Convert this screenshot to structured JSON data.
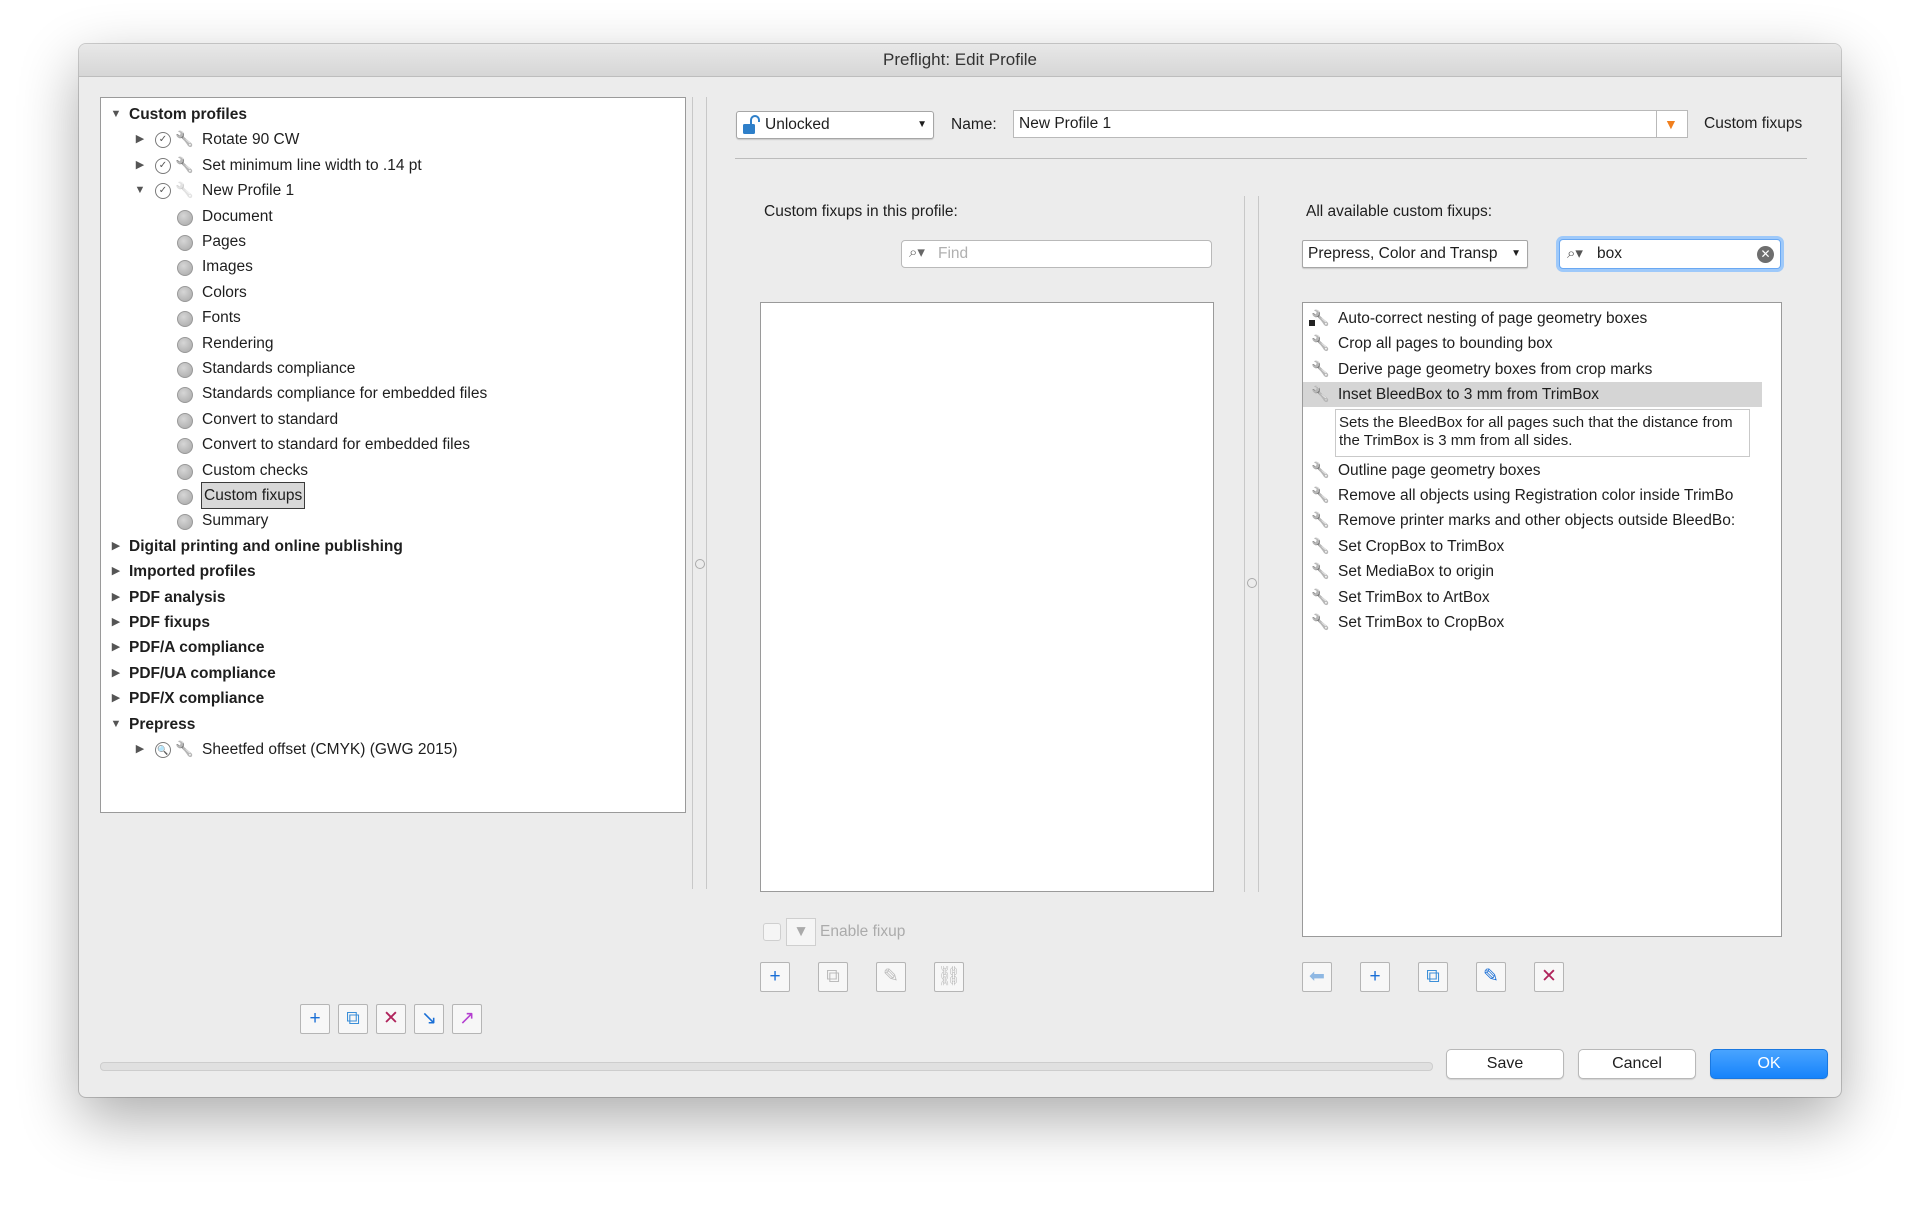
{
  "window": {
    "title": "Preflight: Edit Profile"
  },
  "tree": [
    {
      "label": "Custom profiles",
      "level": 0,
      "bold": true,
      "expanded": true
    },
    {
      "label": "Rotate 90 CW",
      "level": 1,
      "expanded": false,
      "icons": [
        "check-circle-icon",
        "wrench-icon"
      ]
    },
    {
      "label": "Set minimum line width to .14 pt",
      "level": 1,
      "expanded": false,
      "icons": [
        "check-circle-icon",
        "wrench-icon"
      ]
    },
    {
      "label": "New Profile 1",
      "level": 1,
      "expanded": true,
      "icons": [
        "check-circle-icon",
        "wrench-icon"
      ]
    },
    {
      "label": "Document",
      "level": 2,
      "dot": true
    },
    {
      "label": "Pages",
      "level": 2,
      "dot": true
    },
    {
      "label": "Images",
      "level": 2,
      "dot": true
    },
    {
      "label": "Colors",
      "level": 2,
      "dot": true
    },
    {
      "label": "Fonts",
      "level": 2,
      "dot": true
    },
    {
      "label": "Rendering",
      "level": 2,
      "dot": true
    },
    {
      "label": "Standards compliance",
      "level": 2,
      "dot": true
    },
    {
      "label": "Standards compliance for embedded files",
      "level": 2,
      "dot": true
    },
    {
      "label": "Convert to standard",
      "level": 2,
      "dot": true
    },
    {
      "label": "Convert to standard for embedded files",
      "level": 2,
      "dot": true
    },
    {
      "label": "Custom checks",
      "level": 2,
      "dot": true
    },
    {
      "label": "Custom fixups",
      "level": 2,
      "dot": true,
      "selected": true
    },
    {
      "label": "Summary",
      "level": 2,
      "dot": true
    },
    {
      "label": "Digital printing and online publishing",
      "level": 0,
      "bold": true,
      "expanded": false
    },
    {
      "label": "Imported profiles",
      "level": 0,
      "bold": true,
      "expanded": false
    },
    {
      "label": "PDF analysis",
      "level": 0,
      "bold": true,
      "expanded": false
    },
    {
      "label": "PDF fixups",
      "level": 0,
      "bold": true,
      "expanded": false
    },
    {
      "label": "PDF/A compliance",
      "level": 0,
      "bold": true,
      "expanded": false
    },
    {
      "label": "PDF/UA compliance",
      "level": 0,
      "bold": true,
      "expanded": false
    },
    {
      "label": "PDF/X compliance",
      "level": 0,
      "bold": true,
      "expanded": false
    },
    {
      "label": "Prepress",
      "level": 0,
      "bold": true,
      "expanded": true
    },
    {
      "label": "Sheetfed offset (CMYK) (GWG 2015)",
      "level": 1,
      "expanded": false,
      "icons": [
        "lock-magnifier-icon",
        "wrench-icon"
      ]
    }
  ],
  "left_toolbar": [
    {
      "name": "add-profile-button",
      "icon": "+",
      "color": "#1a6fd6"
    },
    {
      "name": "duplicate-profile-button",
      "icon": "⧉",
      "color": "#3c8fd8"
    },
    {
      "name": "delete-profile-button",
      "icon": "✕",
      "color": "#b0245c"
    },
    {
      "name": "import-profile-button",
      "icon": "↘",
      "color": "#1a6fd6"
    },
    {
      "name": "export-profile-button",
      "icon": "↗",
      "color": "#b43fd0"
    }
  ],
  "header": {
    "lock_state": "Unlocked",
    "name_label": "Name:",
    "name_value": "New Profile 1",
    "section_title": "Custom fixups"
  },
  "profile_fixups": {
    "title": "Custom fixups in this profile:",
    "find_placeholder": "Find",
    "enable_label": "Enable fixup",
    "items": []
  },
  "available_fixups": {
    "title": "All available custom fixups:",
    "category": "Prepress, Color and Transp",
    "search_value": "box",
    "items": [
      "Auto-correct nesting of page geometry boxes",
      "Crop all pages to bounding box",
      "Derive page geometry boxes from crop marks",
      "Inset BleedBox to 3 mm from TrimBox",
      "Outline page geometry boxes",
      "Remove all objects using Registration color inside TrimBo",
      "Remove printer marks and other objects outside BleedBo:",
      "Set CropBox to TrimBox",
      "Set MediaBox to origin",
      "Set TrimBox to ArtBox",
      "Set TrimBox to CropBox"
    ],
    "selected_index": 3,
    "selected_description": "Sets the BleedBox for all pages such that the distance from the TrimBox is 3 mm from all sides."
  },
  "footer": {
    "save": "Save",
    "cancel": "Cancel",
    "ok": "OK"
  },
  "colors": {
    "accent": "#1683fb",
    "wrench": "#6f92ad",
    "selection": "#d5d5d5"
  }
}
